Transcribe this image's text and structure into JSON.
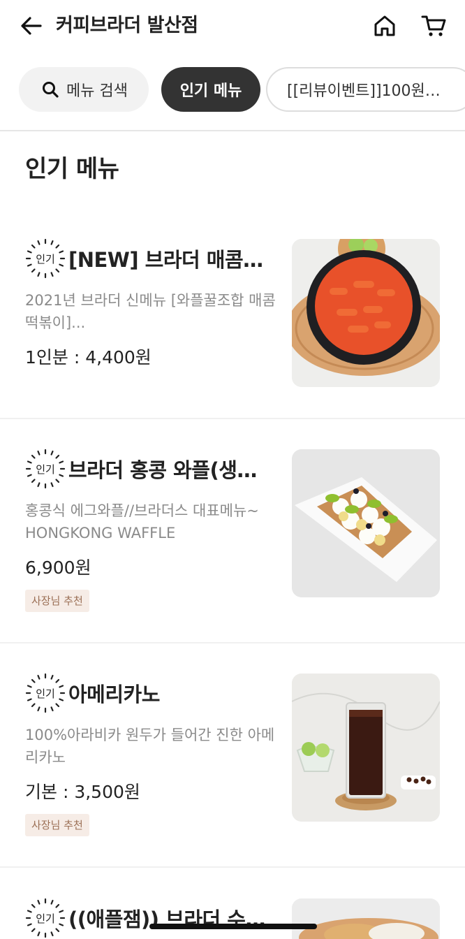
{
  "header": {
    "title": "커피브라더 발산점",
    "back_icon": "back-arrow-icon",
    "home_icon": "home-icon",
    "cart_icon": "cart-icon"
  },
  "chips": {
    "search_label": "메뉴 검색",
    "popular_label": "인기 메뉴",
    "event_label": "[[리뷰이벤트]]100원…"
  },
  "section": {
    "title": "인기 메뉴"
  },
  "badge": {
    "hot_label": "인기"
  },
  "items": [
    {
      "name": "[NEW] 브라더 매콤…",
      "desc": "2021년 브라더 신메뉴 [와플꿀조합 매콤 떡볶이]...",
      "price": "1인분 : 4,400원",
      "tag": ""
    },
    {
      "name": "브라더 홍콩 와플(생…",
      "desc": "홍콩식 에그와플//브라더스 대표메뉴~ HONGKONG WAFFLE",
      "price": "6,900원",
      "tag": "사장님 추천"
    },
    {
      "name": "아메리카노",
      "desc": "100%아라비카 원두가 들어간 진한 아메리카노",
      "price": "기본 : 3,500원",
      "tag": "사장님 추천"
    },
    {
      "name": "((애플잼)) 브라더 수…",
      "desc": "",
      "price": "",
      "tag": ""
    }
  ],
  "colors": {
    "accent_dark": "#333333",
    "badge_bg": "#f6ece6",
    "badge_text": "#9b6f55"
  }
}
